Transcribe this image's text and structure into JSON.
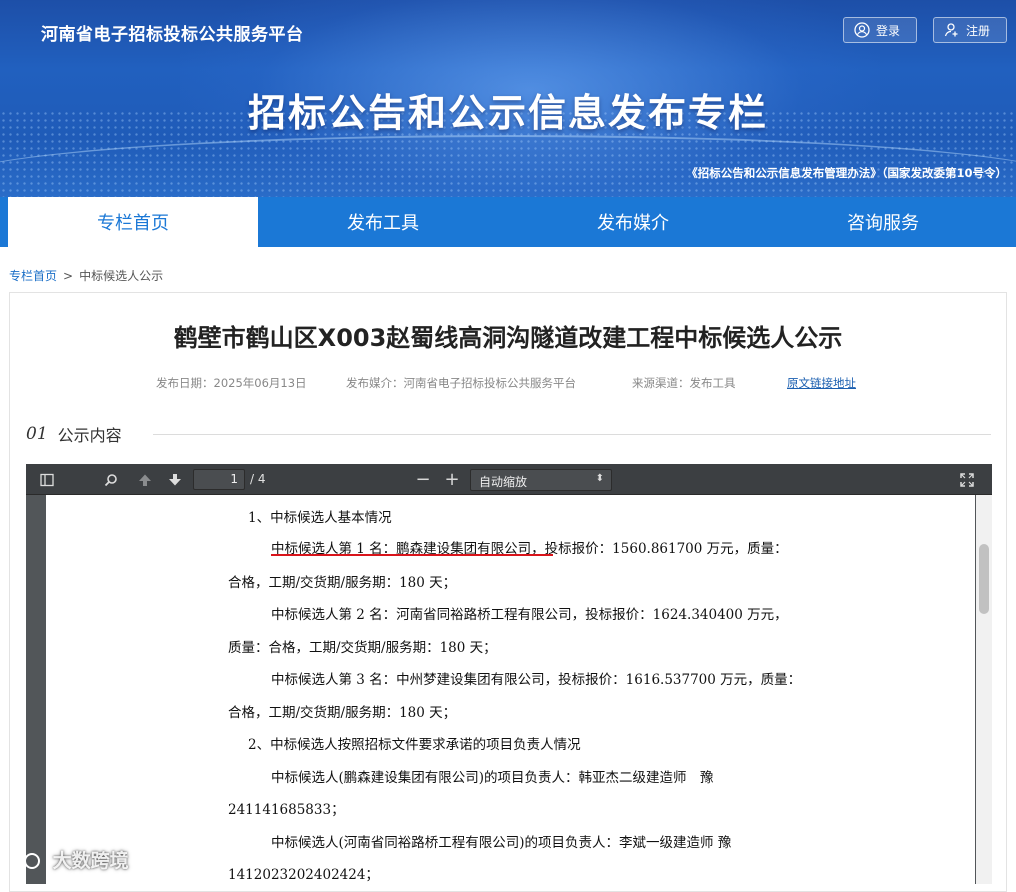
{
  "header": {
    "site_name": "河南省电子招标投标公共服务平台",
    "login_label": "登录",
    "register_label": "注册",
    "banner_title": "招标公告和公示信息发布专栏",
    "banner_note": "《招标公告和公示信息发布管理办法》（国家发改委第10号令）"
  },
  "nav": {
    "tabs": [
      "专栏首页",
      "发布工具",
      "发布媒介",
      "咨询服务"
    ],
    "active": "专栏首页"
  },
  "breadcrumb": {
    "home": "专栏首页",
    "sep": ">",
    "current": "中标候选人公示"
  },
  "article": {
    "title": "鹤壁市鹤山区X003赵蜀线高洞沟隧道改建工程中标候选人公示",
    "publish_date": "发布日期：2025年06月13日",
    "media": "发布媒介：河南省电子招标投标公共服务平台",
    "source": "来源渠道：发布工具",
    "original_link": "原文链接地址",
    "section_num": "01",
    "section_label": "公示内容"
  },
  "viewer": {
    "page_current": "1",
    "page_total": "/ 4",
    "zoom_label": "自动缩放",
    "icons": [
      "sidebar-toggle-icon",
      "search-icon",
      "arrow-up-icon",
      "arrow-down-icon",
      "zoom-out-icon",
      "zoom-in-icon",
      "fullscreen-icon"
    ]
  },
  "pdf": {
    "lines": [
      "1、中标候选人基本情况",
      "中标候选人第 1 名：鹏森建设集团有限公司，投标报价：1560.861700 万元，质量：",
      "合格，工期/交货期/服务期：180 天；",
      "中标候选人第 2 名：河南省同裕路桥工程有限公司，投标报价：1624.340400 万元，",
      "质量：合格，工期/交货期/服务期：180 天；",
      "中标候选人第 3 名：中州梦建设集团有限公司，投标报价：1616.537700 万元，质量：",
      "合格，工期/交货期/服务期：180 天；",
      "2、中标候选人按照招标文件要求承诺的项目负责人情况",
      "中标候选人(鹏森建设集团有限公司)的项目负责人：韩亚杰二级建造师　豫",
      "241141685833；",
      "中标候选人(河南省同裕路桥工程有限公司)的项目负责人：李斌一级建造师 豫",
      "1412023202402424；"
    ]
  },
  "watermark": "大数跨境",
  "colors": {
    "nav_blue": "#1b78d6",
    "highlight_red": "#d9141b"
  }
}
